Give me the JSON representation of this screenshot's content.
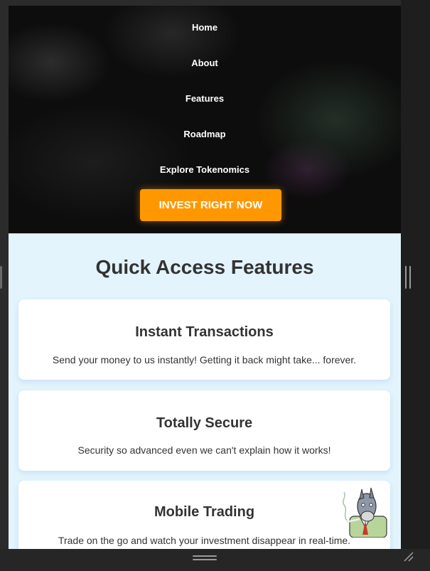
{
  "nav": {
    "items": [
      {
        "label": "Home"
      },
      {
        "label": "About"
      },
      {
        "label": "Features"
      },
      {
        "label": "Roadmap"
      },
      {
        "label": "Explore Tokenomics"
      }
    ],
    "cta_label": "INVEST RIGHT NOW"
  },
  "features": {
    "title": "Quick Access Features",
    "cards": [
      {
        "title": "Instant Transactions",
        "desc": "Send your money to us instantly! Getting it back might take... forever."
      },
      {
        "title": "Totally Secure",
        "desc": "Security so advanced even we can't explain how it works!"
      },
      {
        "title": "Mobile Trading",
        "desc": "Trade on the go and watch your investment disappear in real-time."
      }
    ]
  },
  "colors": {
    "accent": "#ff9800",
    "section_bg": "#e3f4fd",
    "hero_bg": "#0d0d0d"
  },
  "icons": {
    "mascot": "donkey-mascot-icon",
    "resize": "resize-corner-icon"
  }
}
